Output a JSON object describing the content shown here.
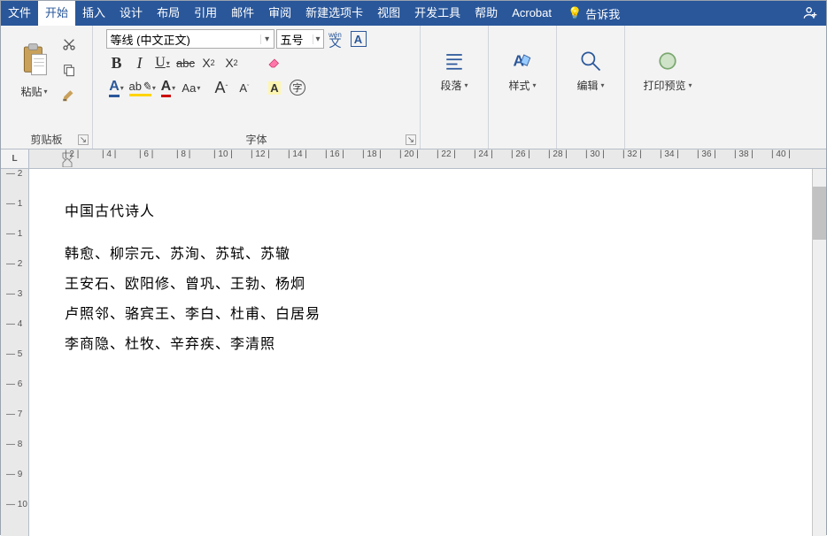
{
  "tabs": {
    "file": "文件",
    "home": "开始",
    "insert": "插入",
    "design": "设计",
    "layout": "布局",
    "references": "引用",
    "mailings": "邮件",
    "review": "审阅",
    "newtab": "新建选项卡",
    "view": "视图",
    "developer": "开发工具",
    "help": "帮助",
    "acrobat": "Acrobat",
    "tellme": "告诉我"
  },
  "ribbon": {
    "clipboard": {
      "paste": "粘贴",
      "label": "剪贴板"
    },
    "font": {
      "font_name": "等线 (中文正文)",
      "font_size": "五号",
      "label": "字体",
      "bold": "B",
      "italic": "I",
      "underline": "U",
      "strike": "abc",
      "sub_x": "X",
      "x_sub": "2",
      "x_sup": "2",
      "A_big": "A",
      "A_small": "A",
      "Aa": "Aa",
      "font_glyph": "A",
      "char_mark": "字"
    },
    "paragraph": {
      "label": "段落"
    },
    "styles": {
      "label": "样式"
    },
    "editing": {
      "label": "编辑"
    },
    "preview": {
      "label": "打印预览"
    }
  },
  "ruler": {
    "corner": "L",
    "ticks": [
      2,
      4,
      6,
      8,
      10,
      12,
      14,
      16,
      18,
      20,
      22,
      24,
      26,
      28,
      30,
      32,
      34,
      36,
      38,
      40
    ]
  },
  "vruler": {
    "ticks": [
      2,
      1,
      1,
      2,
      3,
      4,
      5,
      6,
      7,
      8,
      9,
      10
    ]
  },
  "document": {
    "title": "中国古代诗人",
    "lines": [
      "韩愈、柳宗元、苏洵、苏轼、苏辙",
      "王安石、欧阳修、曾巩、王勃、杨炯",
      "卢照邻、骆宾王、李白、杜甫、白居易",
      "李商隐、杜牧、辛弃疾、李清照"
    ]
  }
}
